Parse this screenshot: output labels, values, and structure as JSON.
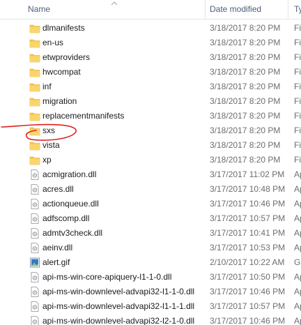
{
  "columns": {
    "name": "Name",
    "date": "Date modified",
    "type": "Ty"
  },
  "rows": [
    {
      "name": "dlmanifests",
      "date": "3/18/2017 8:20 PM",
      "type": "Fil",
      "icon": "folder-icon"
    },
    {
      "name": "en-us",
      "date": "3/18/2017 8:20 PM",
      "type": "Fil",
      "icon": "folder-icon"
    },
    {
      "name": "etwproviders",
      "date": "3/18/2017 8:20 PM",
      "type": "Fil",
      "icon": "folder-icon"
    },
    {
      "name": "hwcompat",
      "date": "3/18/2017 8:20 PM",
      "type": "Fil",
      "icon": "folder-icon"
    },
    {
      "name": "inf",
      "date": "3/18/2017 8:20 PM",
      "type": "Fil",
      "icon": "folder-icon"
    },
    {
      "name": "migration",
      "date": "3/18/2017 8:20 PM",
      "type": "Fil",
      "icon": "folder-icon"
    },
    {
      "name": "replacementmanifests",
      "date": "3/18/2017 8:20 PM",
      "type": "Fil",
      "icon": "folder-icon"
    },
    {
      "name": "sxs",
      "date": "3/18/2017 8:20 PM",
      "type": "Fil",
      "icon": "folder-icon"
    },
    {
      "name": "vista",
      "date": "3/18/2017 8:20 PM",
      "type": "Fil",
      "icon": "folder-icon"
    },
    {
      "name": "xp",
      "date": "3/18/2017 8:20 PM",
      "type": "Fil",
      "icon": "folder-icon"
    },
    {
      "name": "acmigration.dll",
      "date": "3/17/2017 11:02 PM",
      "type": "Ap",
      "icon": "dll-file-icon"
    },
    {
      "name": "acres.dll",
      "date": "3/17/2017 10:48 PM",
      "type": "Ap",
      "icon": "dll-file-icon"
    },
    {
      "name": "actionqueue.dll",
      "date": "3/17/2017 10:46 PM",
      "type": "Ap",
      "icon": "dll-file-icon"
    },
    {
      "name": "adfscomp.dll",
      "date": "3/17/2017 10:57 PM",
      "type": "Ap",
      "icon": "dll-file-icon"
    },
    {
      "name": "admtv3check.dll",
      "date": "3/17/2017 10:41 PM",
      "type": "Ap",
      "icon": "dll-file-icon"
    },
    {
      "name": "aeinv.dll",
      "date": "3/17/2017 10:53 PM",
      "type": "Ap",
      "icon": "dll-file-icon"
    },
    {
      "name": "alert.gif",
      "date": "2/10/2017 10:22 AM",
      "type": "GI",
      "icon": "image-file-icon"
    },
    {
      "name": "api-ms-win-core-apiquery-l1-1-0.dll",
      "date": "3/17/2017 10:50 PM",
      "type": "Ap",
      "icon": "dll-file-icon"
    },
    {
      "name": "api-ms-win-downlevel-advapi32-l1-1-0.dll",
      "date": "3/17/2017 10:46 PM",
      "type": "Ap",
      "icon": "dll-file-icon"
    },
    {
      "name": "api-ms-win-downlevel-advapi32-l1-1-1.dll",
      "date": "3/17/2017 10:57 PM",
      "type": "Ap",
      "icon": "dll-file-icon"
    },
    {
      "name": "api-ms-win-downlevel-advapi32-l2-1-0.dll",
      "date": "3/17/2017 10:46 PM",
      "type": "Ap",
      "icon": "dll-file-icon"
    }
  ],
  "colors": {
    "header_text": "#4c607a",
    "folder": "#f5c54c",
    "annotation": "#e02020"
  }
}
